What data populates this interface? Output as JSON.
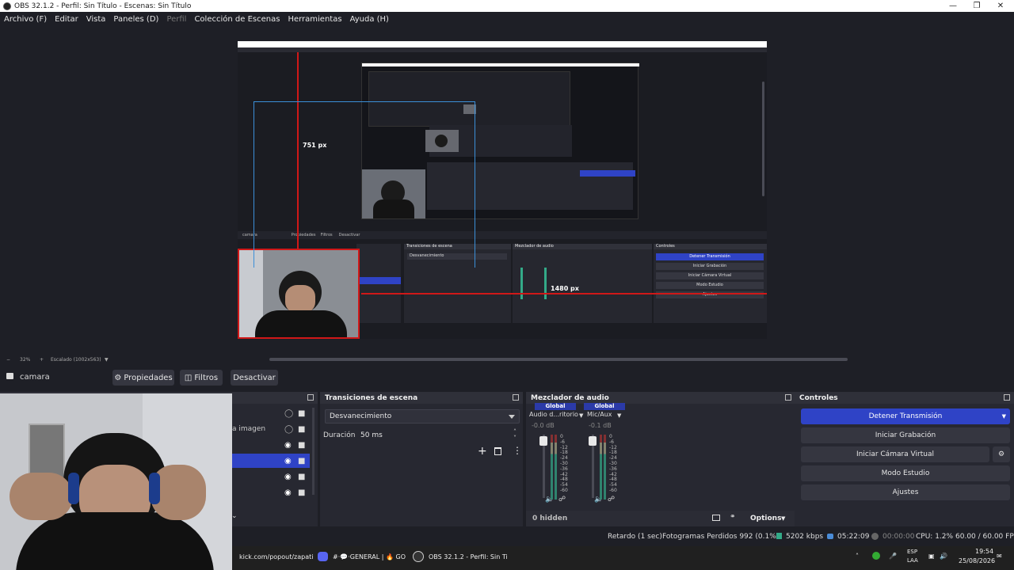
{
  "window": {
    "title": "OBS 32.1.2 - Perfil: Sin Título - Escenas: Sin Título"
  },
  "menu": [
    {
      "label": "Archivo (F)",
      "enabled": true
    },
    {
      "label": "Editar",
      "enabled": true
    },
    {
      "label": "Vista",
      "enabled": true
    },
    {
      "label": "Paneles (D)",
      "enabled": true
    },
    {
      "label": "Perfil",
      "enabled": false
    },
    {
      "label": "Colección de Escenas",
      "enabled": true
    },
    {
      "label": "Herramientas",
      "enabled": true
    },
    {
      "label": "Ayuda (H)",
      "enabled": true
    }
  ],
  "preview": {
    "label_751": "751 px",
    "label_1480": "1480 px",
    "zoom": "32%",
    "scale_label": "Escalado (1002x563)"
  },
  "source_toolbar": {
    "source_name": "camara",
    "properties": "Propiedades",
    "filters": "Filtros",
    "deactivate": "Desactivar"
  },
  "sources_dock": {
    "partial_label": "a imagen"
  },
  "transitions": {
    "title": "Transiciones de escena",
    "selected": "Desvanecimiento",
    "duration_label": "Duración",
    "duration_value": "50 ms"
  },
  "audio_mixer": {
    "title": "Mezclador de audio",
    "channels": [
      {
        "scope": "Global",
        "name": "Audio d...ritorio",
        "db": "-0.0 dB"
      },
      {
        "scope": "Global",
        "name": "Mic/Aux",
        "db": "-0.1 dB"
      }
    ],
    "scale": [
      "0",
      "-6",
      "-12",
      "-18",
      "-24",
      "-30",
      "-36",
      "-42",
      "-48",
      "-54",
      "-60"
    ],
    "hidden": "0 hidden",
    "options": "Options"
  },
  "controls": {
    "title": "Controles",
    "stop_stream": "Detener Transmisión",
    "start_recording": "Iniciar Grabación",
    "virtual_camera": "Iniciar Cámara Virtual",
    "studio_mode": "Modo Estudio",
    "settings": "Ajustes"
  },
  "status": {
    "delay": "Retardo (1 sec)",
    "dropped": "Fotogramas Perdidos 992 (0.1%)",
    "bitrate": "5202 kbps",
    "stream_time": "05:22:09",
    "rec_time": "00:00:00",
    "cpu": "CPU: 1.2%",
    "fps": "60.00 / 60.00 FPS"
  },
  "taskbar": {
    "browser": "kick.com/popout/zapati",
    "discord": "#·💬·GENERAL | 🔥 GO",
    "obs": "OBS 32.1.2 - Perfil: Sin Ti",
    "lang1": "ESP",
    "lang2": "LAA",
    "time": "19:54",
    "date": "25/08/2026"
  },
  "colors": {
    "accent": "#2f43c6",
    "bg": "#1e1f26",
    "dock": "#272831",
    "red_guide": "#d01818",
    "blue_guide": "#3b8fd8"
  }
}
